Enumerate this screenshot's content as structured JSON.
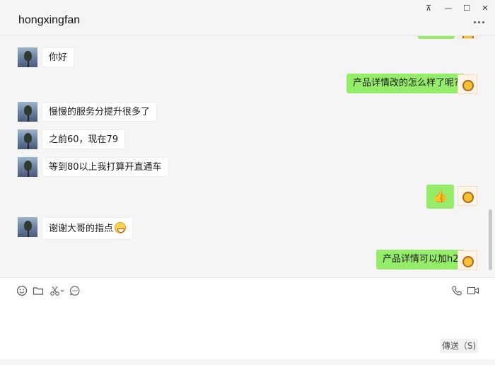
{
  "window": {
    "title": "hongxingfan",
    "controls": {
      "pin": "⊼",
      "minimize": "—",
      "maximize": "☐",
      "close": "✕"
    }
  },
  "colors": {
    "outgoing_bubble": "#95ec69",
    "incoming_bubble": "#ffffff",
    "background": "#f5f5f5"
  },
  "messages": [
    {
      "side": "in",
      "text": "你好"
    },
    {
      "side": "out",
      "text": "产品详情改的怎么样了呢?"
    },
    {
      "side": "in",
      "text": "慢慢的服务分提升很多了"
    },
    {
      "side": "in",
      "text": "之前60，现在79"
    },
    {
      "side": "in",
      "text": "等到80以上我打算开直通车"
    },
    {
      "side": "out",
      "text": "",
      "emoji": "thumbs-up-emoji"
    },
    {
      "side": "in",
      "text": "谢谢大哥的指点",
      "emoji": "grin-emoji"
    },
    {
      "side": "out",
      "text": "产品详情可以加h2"
    }
  ],
  "composer": {
    "tools": [
      "emoji-icon",
      "folder-icon",
      "scissors-icon",
      "chat-history-icon"
    ],
    "calls": [
      "phone-icon",
      "video-icon"
    ],
    "send_label": "傳送（S)"
  }
}
